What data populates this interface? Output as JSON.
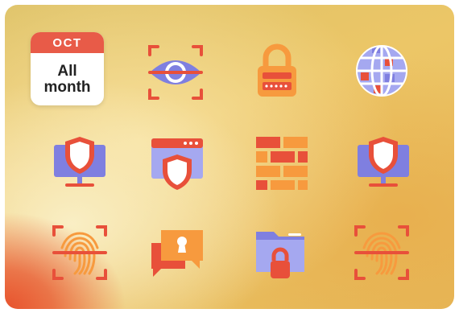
{
  "calendar": {
    "month": "OCT",
    "subtitle": "All month"
  },
  "colors": {
    "red": "#e8503a",
    "orange": "#f79a3e",
    "purple": "#7f7fe0",
    "lavender": "#a5a8f0",
    "white": "#ffffff"
  },
  "icons": [
    "eye-scan-icon",
    "padlock-password-icon",
    "globe-icon",
    "monitor-shield-icon",
    "browser-shield-icon",
    "firewall-icon",
    "monitor-shield-icon",
    "fingerprint-scan-icon",
    "chat-keyhole-icon",
    "folder-lock-icon",
    "fingerprint-scan-icon"
  ]
}
